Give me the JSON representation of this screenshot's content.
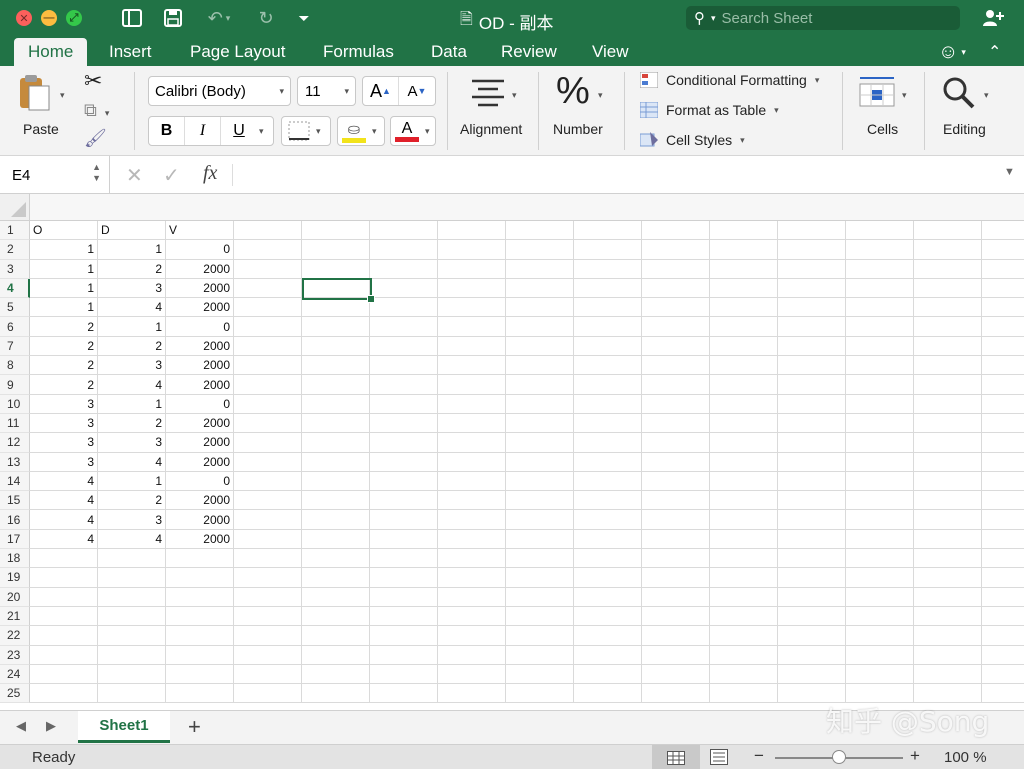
{
  "window": {
    "title": "OD - 副本",
    "search_placeholder": "Search Sheet"
  },
  "tabs": [
    "Home",
    "Insert",
    "Page Layout",
    "Formulas",
    "Data",
    "Review",
    "View"
  ],
  "active_tab": "Home",
  "ribbon": {
    "paste_label": "Paste",
    "font_name": "Calibri (Body)",
    "font_size": "11",
    "bold": "B",
    "italic": "I",
    "underline": "U",
    "grow_font": "A",
    "shrink_font": "A",
    "font_color_glyph": "A",
    "alignment_label": "Alignment",
    "number_label": "Number",
    "number_glyph": "%",
    "conditional_formatting": "Conditional Formatting",
    "format_as_table": "Format as Table",
    "cell_styles": "Cell Styles",
    "cells_label": "Cells",
    "editing_label": "Editing"
  },
  "formula_bar": {
    "name_box": "E4",
    "fx": "fx",
    "value": ""
  },
  "columns": [
    "O",
    "D",
    "V"
  ],
  "rows": [
    [
      "1",
      "1",
      "0"
    ],
    [
      "1",
      "2",
      "2000"
    ],
    [
      "1",
      "3",
      "2000"
    ],
    [
      "1",
      "4",
      "2000"
    ],
    [
      "2",
      "1",
      "0"
    ],
    [
      "2",
      "2",
      "2000"
    ],
    [
      "2",
      "3",
      "2000"
    ],
    [
      "2",
      "4",
      "2000"
    ],
    [
      "3",
      "1",
      "0"
    ],
    [
      "3",
      "2",
      "2000"
    ],
    [
      "3",
      "3",
      "2000"
    ],
    [
      "3",
      "4",
      "2000"
    ],
    [
      "4",
      "1",
      "0"
    ],
    [
      "4",
      "2",
      "2000"
    ],
    [
      "4",
      "3",
      "2000"
    ],
    [
      "4",
      "4",
      "2000"
    ]
  ],
  "row_numbers": [
    "1",
    "2",
    "3",
    "4",
    "5",
    "6",
    "7",
    "8",
    "9",
    "10",
    "11",
    "12",
    "13",
    "14",
    "15",
    "16",
    "17",
    "18",
    "19",
    "20",
    "21",
    "22",
    "23",
    "24",
    "25"
  ],
  "active_row": "4",
  "sheet_tabs": [
    "Sheet1"
  ],
  "add_sheet": "+",
  "status": {
    "ready": "Ready",
    "zoom": "100 %",
    "zoom_minus": "−",
    "zoom_plus": "+"
  },
  "watermark": "知乎 @Song",
  "colors": {
    "accent": "#217346",
    "highlight_yellow": "#f2e31b",
    "font_red": "#e0202a"
  }
}
